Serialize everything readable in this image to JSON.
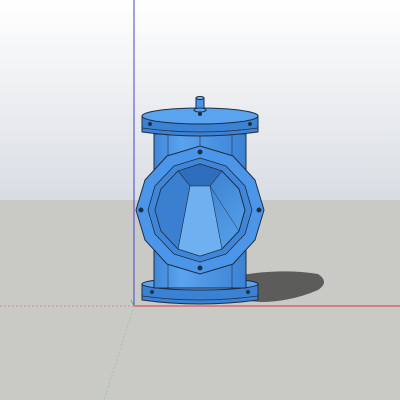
{
  "app": {
    "type": "3d-modeling-viewport"
  },
  "scene": {
    "sky_color_top": "#ffffff",
    "sky_color_horizon": "#d9dde3",
    "ground_color": "#c9c9c6",
    "model_color": "#4b96e8",
    "model_dark": "#2f74c6",
    "model_light": "#7db8f2",
    "edge_color": "#1f2e44",
    "shadow_color": "#5c5c5a",
    "axis_colors": {
      "blue_vertical": "#4646c8",
      "red_horizontal": "#d93b3b",
      "green": "#6cae6c"
    },
    "object": "valve-model"
  }
}
